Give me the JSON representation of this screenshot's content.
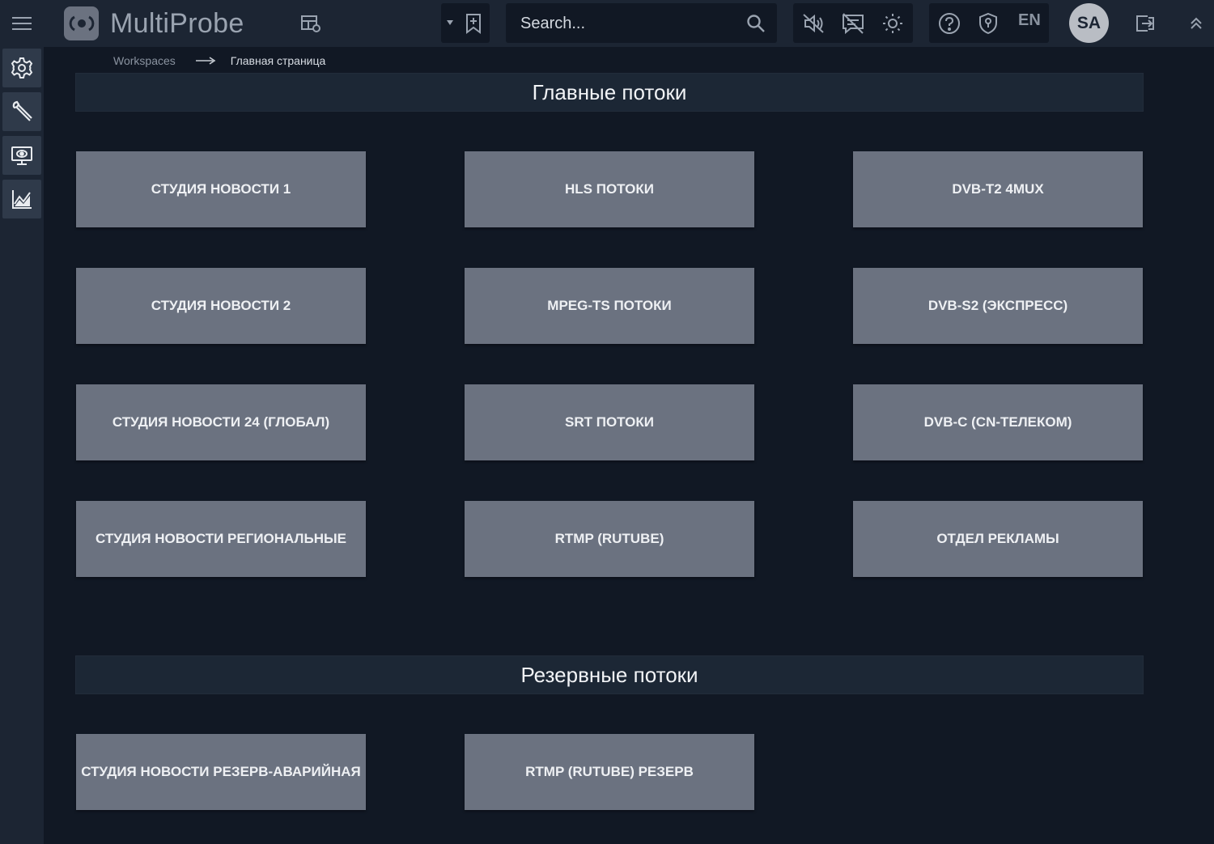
{
  "app": {
    "logo_light": "Multi",
    "logo_bold": "Probe"
  },
  "search": {
    "placeholder": "Search..."
  },
  "header": {
    "language": "EN",
    "avatar_initials": "SA",
    "icons": [
      "menu-icon",
      "layout-settings-icon",
      "dropdown-caret-icon",
      "bookmark-add-icon",
      "search-icon",
      "mute-icon",
      "comments-off-icon",
      "brightness-icon",
      "help-icon",
      "shield-icon",
      "logout-icon",
      "collapse-up-icon"
    ]
  },
  "sidebar": {
    "items": [
      {
        "name": "settings",
        "icon": "gear-icon"
      },
      {
        "name": "tools",
        "icon": "wrench-icon"
      },
      {
        "name": "monitor",
        "icon": "monitor-icon"
      },
      {
        "name": "statistics",
        "icon": "chart-icon"
      }
    ]
  },
  "breadcrumb": {
    "root": "Workspaces",
    "current": "Главная страница"
  },
  "sections": [
    {
      "title": "Главные потоки",
      "tiles": [
        "СТУДИЯ НОВОСТИ 1",
        "HLS ПОТОКИ",
        "DVB-T2 4MUX",
        "СТУДИЯ НОВОСТИ 2",
        "MPEG-TS ПОТОКИ",
        "DVB-S2 (ЭКСПРЕСС)",
        "СТУДИЯ НОВОСТИ 24 (ГЛОБАЛ)",
        "SRT ПОТОКИ",
        "DVB-C (CN-ТЕЛЕКОМ)",
        "СТУДИЯ НОВОСТИ РЕГИОНАЛЬНЫЕ",
        "RTMP (RUTUBE)",
        "ОТДЕЛ РЕКЛАМЫ"
      ]
    },
    {
      "title": "Резервные потоки",
      "tiles": [
        "СТУДИЯ НОВОСТИ РЕЗЕРВ-АВАРИЙНАЯ",
        "RTMP (RUTUBE) РЕЗЕРВ"
      ]
    }
  ],
  "colors": {
    "background": "#111824",
    "bar": "#1c2533",
    "tile": "#6b7280"
  }
}
